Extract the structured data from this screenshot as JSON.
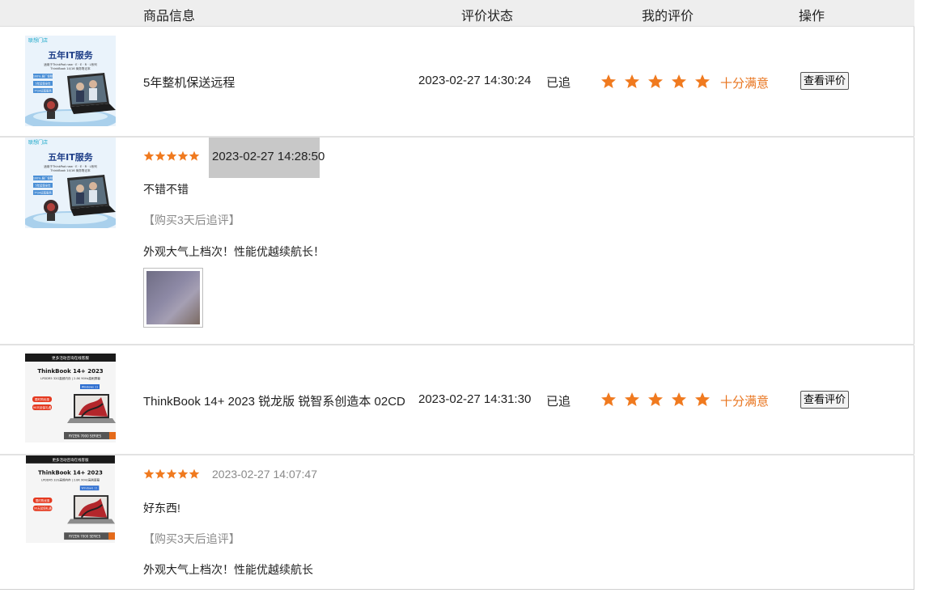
{
  "header": {
    "col_product": "商品信息",
    "col_status": "评价状态",
    "col_rating": "我的评价",
    "col_action": "操作"
  },
  "orders": [
    {
      "thumb": {
        "brand": "联想门店",
        "headline": "五年IT服务",
        "sub1": "适用于ThinkPad new · E · E · R · L系列",
        "sub2": "ThinkBook 14/16 商务笔记本",
        "badges": [
          "100% 原厂保障",
          "5年延保全年",
          "7*24远程服务"
        ]
      },
      "product_name": "5年整机保送远程",
      "review_time": "2023-02-27 14:30:24",
      "status": "已追",
      "rating": 5,
      "satisfaction": "十分满意",
      "action_label": "查看评价",
      "followup": {
        "rating": 5,
        "time": "2023-02-27 14:28:50",
        "comment": "不错不错",
        "tag": "【购买3天后追评】",
        "followup_comment": "外观大气上档次！性能优越续航长！"
      }
    },
    {
      "thumb": {
        "banner": "更多活动咨询在线客服",
        "title": "ThinkBook 14+ 2023",
        "spec": "LPDDR5 32G高频内存 | 2.8K 90Hz高刷屏幕",
        "tags": [
          "限时购优惠",
          "90天延保礼遇"
        ],
        "win": "Windows 11",
        "cpu": "RYZEN 7000 SERIES"
      },
      "product_name": "ThinkBook 14+ 2023 锐龙版 锐智系创造本 02CD",
      "review_time": "2023-02-27 14:31:30",
      "status": "已追",
      "rating": 5,
      "satisfaction": "十分满意",
      "action_label": "查看评价",
      "followup": {
        "rating": 5,
        "time": "2023-02-27 14:07:47",
        "comment": "好东西!",
        "tag": "【购买3天后追评】",
        "followup_comment": "外观大气上档次！性能优越续航长"
      }
    }
  ],
  "colors": {
    "star": "#f07a1f",
    "satisfaction": "#e8741e",
    "header_bg": "#eeeeee",
    "time_highlight": "#c8c8c8"
  }
}
